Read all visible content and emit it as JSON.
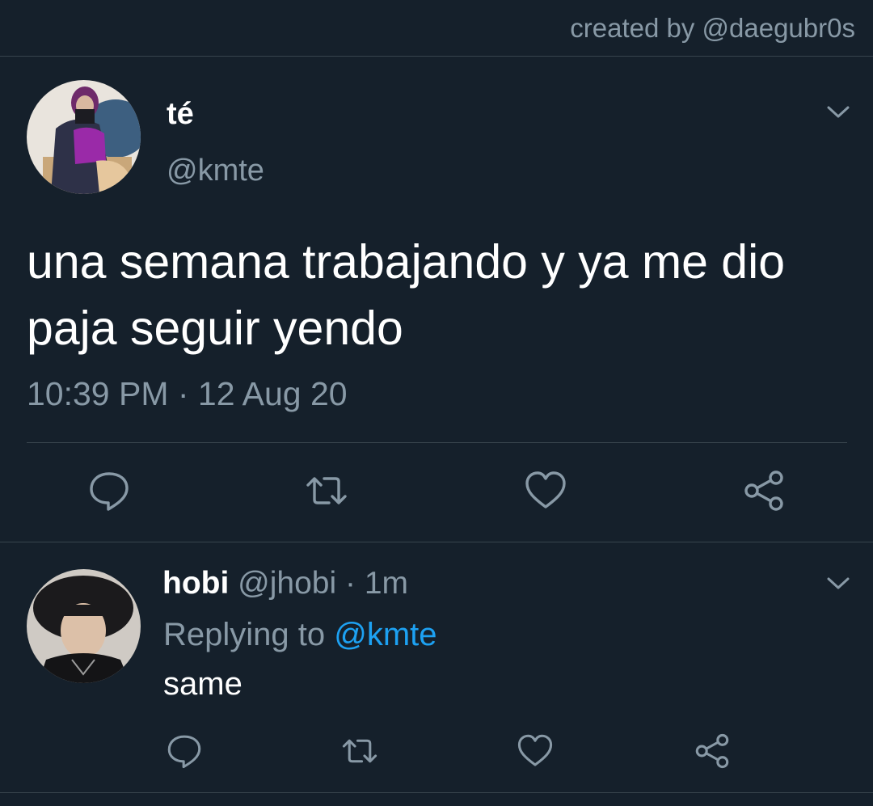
{
  "watermark": "created by @daegubr0s",
  "main_tweet": {
    "name": "té",
    "handle": "@kmte",
    "text": "una semana trabajando y ya me dio paja seguir yendo",
    "timestamp": "10:39 PM · 12 Aug 20",
    "actions": [
      "reply-icon",
      "retweet-icon",
      "like-icon",
      "share-icon"
    ]
  },
  "reply_tweet": {
    "name": "hobi",
    "handle": "@jhobi",
    "separator": "·",
    "age": "1m",
    "replying_prefix": "Replying to",
    "replying_to": "@kmte",
    "text": "same",
    "actions": [
      "reply-icon",
      "retweet-icon",
      "like-icon",
      "share-icon"
    ]
  },
  "colors": {
    "background": "#15202b",
    "secondary_text": "#8899a6",
    "divider": "#38444d",
    "mention": "#1da1f2"
  }
}
